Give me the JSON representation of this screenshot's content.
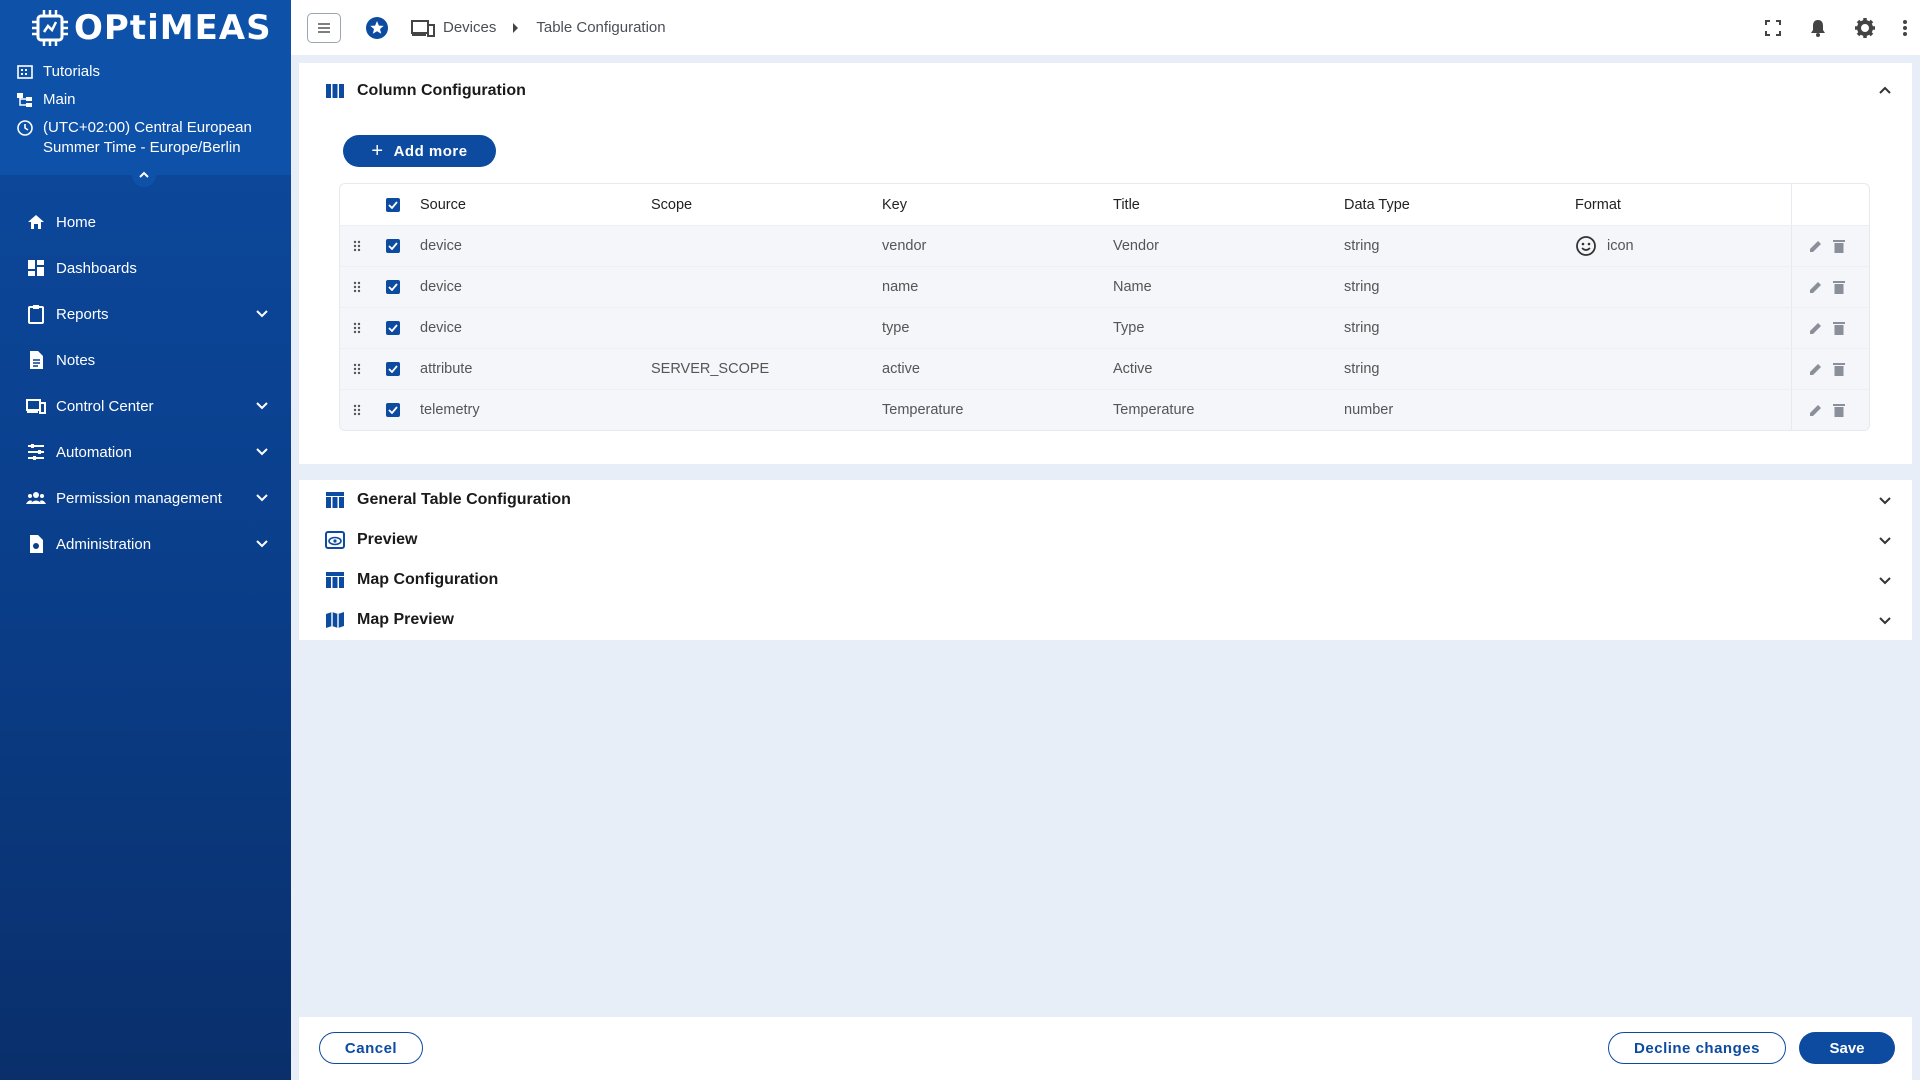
{
  "brand": {
    "logo_text": "OPtiMEAS",
    "tutorials": "Tutorials",
    "main": "Main",
    "timezone": "(UTC+02:00) Central European Summer Time - Europe/Berlin"
  },
  "nav": {
    "home": "Home",
    "dashboards": "Dashboards",
    "reports": "Reports",
    "notes": "Notes",
    "control_center": "Control Center",
    "automation": "Automation",
    "permission_management": "Permission management",
    "administration": "Administration"
  },
  "breadcrumb": {
    "devices": "Devices",
    "current": "Table Configuration"
  },
  "column_config": {
    "title": "Column Configuration",
    "add_more": "Add more",
    "headers": {
      "source": "Source",
      "scope": "Scope",
      "key": "Key",
      "title": "Title",
      "data_type": "Data Type",
      "format": "Format"
    },
    "rows": [
      {
        "source": "device",
        "scope": "",
        "key": "vendor",
        "title": "Vendor",
        "data_type": "string",
        "format": "icon"
      },
      {
        "source": "device",
        "scope": "",
        "key": "name",
        "title": "Name",
        "data_type": "string",
        "format": ""
      },
      {
        "source": "device",
        "scope": "",
        "key": "type",
        "title": "Type",
        "data_type": "string",
        "format": ""
      },
      {
        "source": "attribute",
        "scope": "SERVER_SCOPE",
        "key": "active",
        "title": "Active",
        "data_type": "string",
        "format": ""
      },
      {
        "source": "telemetry",
        "scope": "",
        "key": "Temperature",
        "title": "Temperature",
        "data_type": "number",
        "format": ""
      }
    ]
  },
  "sections": {
    "general_table": "General Table Configuration",
    "preview": "Preview",
    "map_config": "Map Configuration",
    "map_preview": "Map Preview"
  },
  "footer": {
    "cancel": "Cancel",
    "decline": "Decline changes",
    "save": "Save"
  },
  "colors": {
    "primary": "#0d4ba0",
    "sidebar": "#0d51a8"
  }
}
